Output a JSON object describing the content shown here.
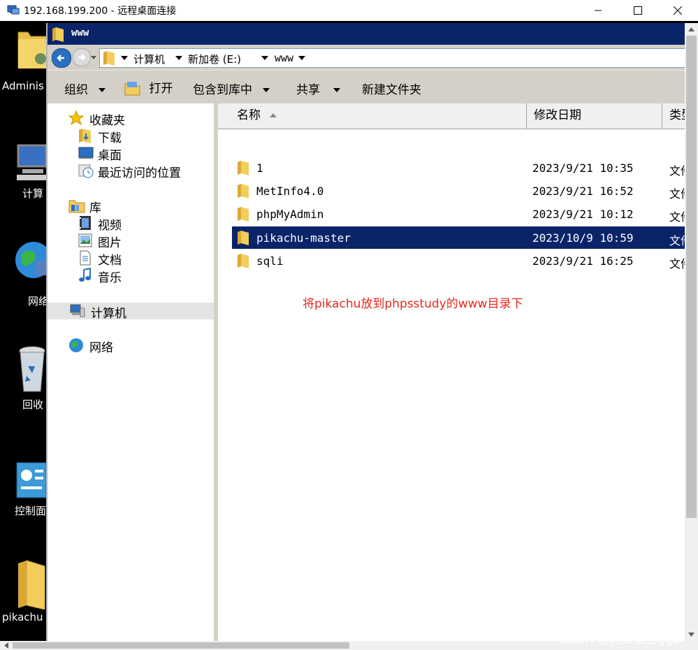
{
  "rdp": {
    "title": "192.168.199.200 - 远程桌面连接",
    "controls": [
      "minimize",
      "maximize",
      "close"
    ]
  },
  "desktop": {
    "icons": [
      {
        "label": "Adminis",
        "icon": "user-folder-icon"
      },
      {
        "label": "计算",
        "icon": "computer-icon"
      },
      {
        "label": "网络",
        "icon": "network-globe-icon"
      },
      {
        "label": "回收",
        "icon": "recycle-bin-icon"
      },
      {
        "label": "控制面",
        "icon": "control-panel-icon"
      },
      {
        "label": "pikachu",
        "icon": "folder-icon"
      }
    ]
  },
  "explorer": {
    "title": "www",
    "breadcrumb": [
      "计算机",
      "新加卷 (E:)",
      "www"
    ],
    "toolbar": {
      "organize": "组织",
      "open": "打开",
      "include_in_library": "包含到库中",
      "share": "共享",
      "new_folder": "新建文件夹"
    },
    "nav": {
      "favorites": "收藏夹",
      "downloads": "下载",
      "desktop": "桌面",
      "recent": "最近访问的位置",
      "libraries": "库",
      "videos": "视频",
      "pictures": "图片",
      "documents": "文档",
      "music": "音乐",
      "computer": "计算机",
      "network": "网络"
    },
    "columns": {
      "name": "名称",
      "modified": "修改日期",
      "type": "类型"
    },
    "files": [
      {
        "name": "1",
        "modified": "2023/9/21 10:35",
        "type": "文件"
      },
      {
        "name": "MetInfo4.0",
        "modified": "2023/9/21 16:52",
        "type": "文件"
      },
      {
        "name": "phpMyAdmin",
        "modified": "2023/9/21 10:12",
        "type": "文件"
      },
      {
        "name": "pikachu-master",
        "modified": "2023/10/9 10:59",
        "type": "文件",
        "selected": true
      },
      {
        "name": "sqli",
        "modified": "2023/9/21 16:25",
        "type": "文件"
      }
    ]
  },
  "annotation": "将pikachu放到phpsstudy的www目录下",
  "watermark": "CSDN @网络安全ggb",
  "colors": {
    "selection": "#0a246a",
    "annotation": "#e8271c",
    "chrome": "#d4d0c8"
  }
}
